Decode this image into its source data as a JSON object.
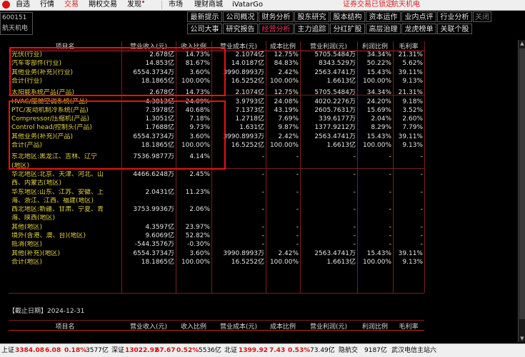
{
  "menu": {
    "items": [
      {
        "label": "自选",
        "active": false
      },
      {
        "label": "行情",
        "active": false
      },
      {
        "label": "交易",
        "active": true
      },
      {
        "label": "期权交易",
        "active": false
      },
      {
        "label": "发现",
        "active": false,
        "badge": true
      },
      {
        "label": "市场",
        "active": false
      },
      {
        "label": "理财商城",
        "active": false
      },
      {
        "label": "iVatarGo",
        "active": false
      }
    ],
    "notice": "证券交易已锁定",
    "stock_name": "航天机电"
  },
  "stock": {
    "code": "600151",
    "name": "航天机电"
  },
  "nav": {
    "row1": [
      "最新提示",
      "公司概况",
      "财务分析",
      "股东研究",
      "股本结构",
      "资本运作",
      "业内点评",
      "行业分析",
      "关闭"
    ],
    "row2": [
      "公司大事",
      "研究报告",
      "经营分析",
      "主力追踪",
      "分红扩股",
      "高层治理",
      "龙虎榜单",
      "关联个股"
    ],
    "active": "经营分析"
  },
  "table": {
    "headers": [
      "项目名",
      "营业收入(元)",
      "收入比例",
      "营业成本(元)",
      "成本比例",
      "营业利润(元)",
      "利润比例",
      "毛利率"
    ],
    "rows": [
      [
        "光伏(行业)",
        "2.678亿",
        "14.73%",
        "2.1074亿",
        "12.75%",
        "5705.5484万",
        "34.34%",
        "21.31%"
      ],
      [
        "汽车零部件(行业)",
        "14.853亿",
        "81.67%",
        "14.0187亿",
        "84.83%",
        "8343.529万",
        "50.22%",
        "5.62%"
      ],
      [
        "其他业务(补充)(行业)",
        "6554.3734万",
        "3.60%",
        "3990.8993万",
        "2.42%",
        "2563.4741万",
        "15.43%",
        "39.11%"
      ],
      [
        "合计(行业)",
        "18.1865亿",
        "100.00%",
        "16.5252亿",
        "100.00%",
        "1.6613亿",
        "100.00%",
        "9.13%"
      ],
      [
        "太阳能系统产品(产品)",
        "2.678亿",
        "14.73%",
        "2.1074亿",
        "12.75%",
        "5705.5484万",
        "34.34%",
        "21.31%"
      ],
      [
        "HVAC/座舱空调系统(产品)",
        "4.3813亿",
        "24.09%",
        "3.9793亿",
        "24.08%",
        "4020.2276万",
        "24.20%",
        "9.18%"
      ],
      [
        "PTC/发动机制冷系统(产品)",
        "7.3978亿",
        "40.68%",
        "7.1373亿",
        "43.19%",
        "2605.7631万",
        "15.69%",
        "3.52%"
      ],
      [
        "Compressor/压缩机(产品)",
        "1.3051亿",
        "7.18%",
        "1.2718亿",
        "7.69%",
        "339.6177万",
        "2.04%",
        "2.60%"
      ],
      [
        "Control head/控制头(产品)",
        "1.7688亿",
        "9.73%",
        "1.631亿",
        "9.87%",
        "1377.9212万",
        "8.29%",
        "7.79%"
      ],
      [
        "其他业务(补充)(产品)",
        "6554.3734万",
        "3.60%",
        "3990.8993万",
        "2.42%",
        "2563.4741万",
        "15.43%",
        "39.11%"
      ],
      [
        "合计(产品)",
        "18.1865亿",
        "100.00%",
        "16.5252亿",
        "100.00%",
        "1.6613亿",
        "100.00%",
        "9.13%"
      ],
      [
        "东北地区:黑龙江、吉林、辽宁",
        "7536.9877万",
        "4.14%",
        "-",
        "-",
        "-",
        "-",
        "-"
      ],
      [
        "(地区)",
        "",
        "",
        "",
        "",
        "",
        "",
        ""
      ],
      [
        "华北地区:北京、天津、河北、山",
        "4466.6248万",
        "2.45%",
        "-",
        "-",
        "-",
        "-",
        "-"
      ],
      [
        "西、内蒙古(地区)",
        "",
        "",
        "",
        "",
        "",
        "",
        ""
      ],
      [
        "华东地区:山东、江苏、安徽、上",
        "2.0431亿",
        "11.23%",
        "-",
        "-",
        "-",
        "-",
        "-"
      ],
      [
        "海、浙江、江西、福建(地区)",
        "",
        "",
        "",
        "",
        "",
        "",
        ""
      ],
      [
        "西北地区:新疆、甘肃、宁夏、青",
        "3753.9936万",
        "2.06%",
        "-",
        "-",
        "-",
        "-",
        "-"
      ],
      [
        "海、陕西(地区)",
        "",
        "",
        "",
        "",
        "",
        "",
        ""
      ],
      [
        "其他(地区)",
        "4.3597亿",
        "23.97%",
        "-",
        "-",
        "-",
        "-",
        "-"
      ],
      [
        "境外(含港、澳、台)(地区)",
        "9.6069亿",
        "52.82%",
        "-",
        "-",
        "-",
        "-",
        "-"
      ],
      [
        "抵消(地区)",
        "-544.3576万",
        "-0.30%",
        "-",
        "-",
        "-",
        "-",
        "-"
      ],
      [
        "其他(补充)(地区)",
        "6554.3734万",
        "3.60%",
        "3990.8993万",
        "2.42%",
        "2563.4741万",
        "15.43%",
        "39.11%"
      ],
      [
        "合计(地区)",
        "18.1865亿",
        "100.00%",
        "16.5252亿",
        "100.00%",
        "1.6613亿",
        "100.00%",
        "9.13%"
      ]
    ]
  },
  "section2": {
    "title": "【截止日期】2024-12-31",
    "headers": [
      "项目名",
      "营业收入(元)",
      "收入比例",
      "营业成本(元)",
      "成本比例",
      "营业利润(元)",
      "利润比例",
      "毛利率"
    ]
  },
  "status": {
    "sh": {
      "label": "上证",
      "value": "3384.08",
      "change": "6.08",
      "pct": "0.18%",
      "vol": "3577亿"
    },
    "sz": {
      "label": "深证",
      "value": "13022.92",
      "change": "67.67",
      "pct": "0.52%",
      "vol": "5536亿"
    },
    "bz": {
      "label": "北证",
      "value": "1399.92",
      "change": "7.43",
      "pct": "0.53%",
      "vol": "73.49亿"
    },
    "quote": "隐航交",
    "quote_vol": "9187亿",
    "site": "武汉电信主站六"
  },
  "colors": {
    "background": "#000000",
    "label": "#e3d040",
    "value": "#e5e5e5",
    "accent_red": "#e11111",
    "rise": "#d11111"
  }
}
